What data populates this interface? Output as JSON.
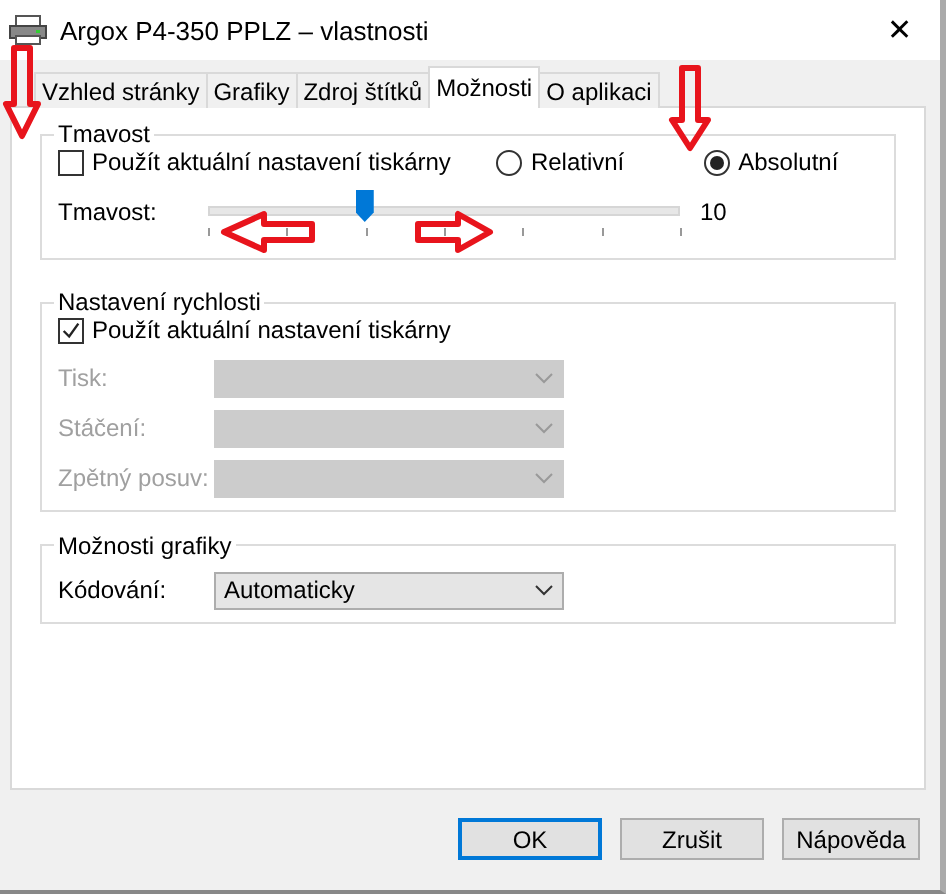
{
  "window": {
    "title": "Argox P4-350 PPLZ – vlastnosti",
    "close": "✕"
  },
  "tabs": [
    {
      "label": "Vzhled stránky",
      "selected": false
    },
    {
      "label": "Grafiky",
      "selected": false
    },
    {
      "label": "Zdroj štítků",
      "selected": false
    },
    {
      "label": "Možnosti",
      "selected": true
    },
    {
      "label": "O aplikaci",
      "selected": false
    }
  ],
  "darkness": {
    "title": "Tmavost",
    "use_printer": {
      "label": "Použít aktuální nastavení tiskárny",
      "checked": false
    },
    "modes": [
      {
        "label": "Relativní",
        "selected": false
      },
      {
        "label": "Absolutní",
        "selected": true
      }
    ],
    "slider": {
      "label": "Tmavost:",
      "level": 0.33,
      "reading": "10"
    }
  },
  "speed": {
    "title": "Nastavení rychlosti",
    "use_printer": {
      "label": "Použít aktuální nastavení tiskárny",
      "checked": true
    },
    "fields": [
      {
        "label": "Tisk:",
        "disabled": true
      },
      {
        "label": "Stáčení:",
        "disabled": true
      },
      {
        "label": "Zpětný posuv:",
        "disabled": true
      }
    ]
  },
  "graphics": {
    "title": "Možnosti grafiky",
    "fields": [
      {
        "label": "Kódování:",
        "value": "Automaticky",
        "disabled": false
      }
    ]
  },
  "buttons": [
    {
      "label": "OK",
      "default": true
    },
    {
      "label": "Zrušit",
      "default": false
    },
    {
      "label": "Nápověda",
      "default": false
    }
  ]
}
